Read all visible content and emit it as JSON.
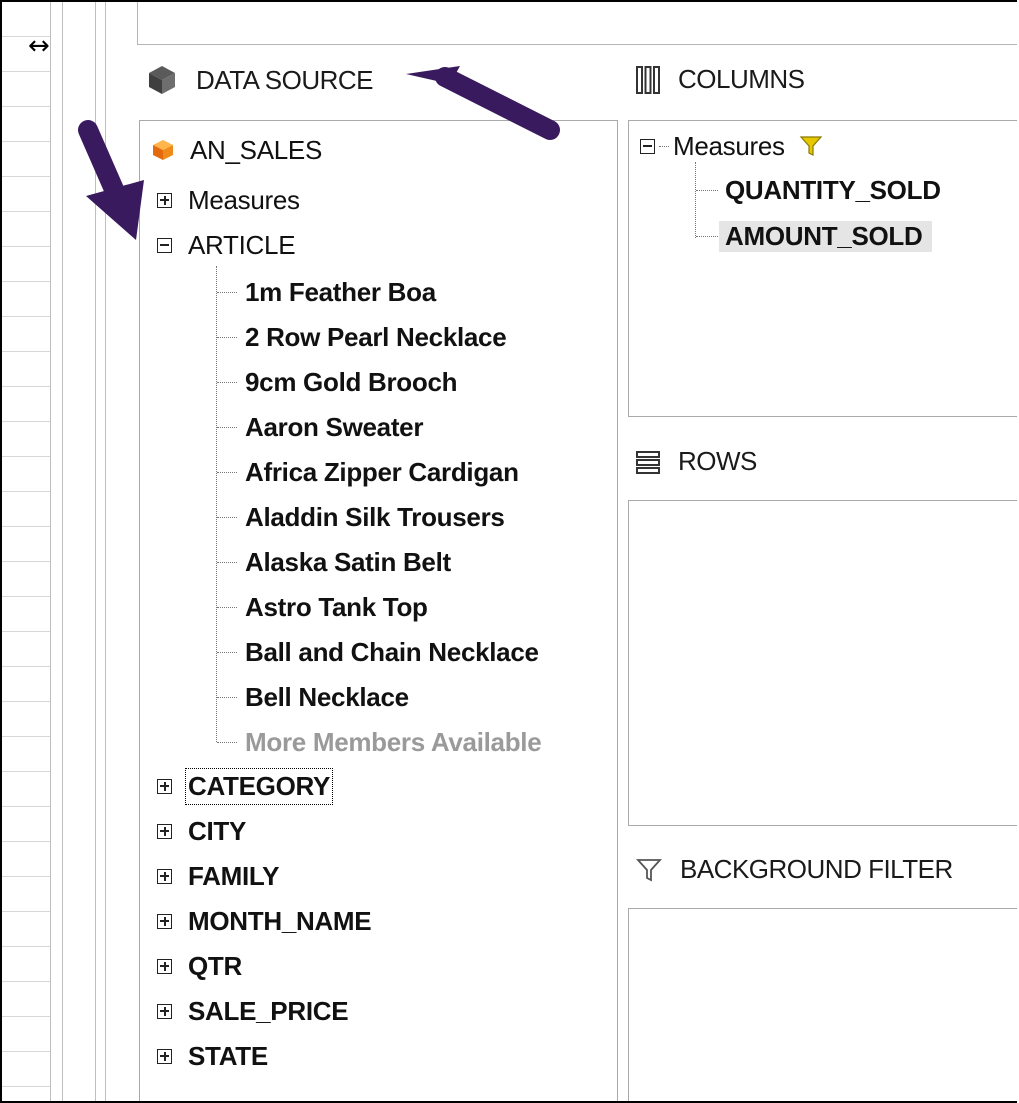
{
  "sections": {
    "data_source": "DATA SOURCE",
    "columns": "COLUMNS",
    "rows": "ROWS",
    "background_filter": "BACKGROUND FILTER"
  },
  "data_source_tree": {
    "root": "AN_SALES",
    "measures": "Measures",
    "article": {
      "label": "ARTICLE",
      "members": [
        "1m Feather Boa",
        "2 Row Pearl Necklace",
        "9cm Gold Brooch",
        "Aaron Sweater",
        "Africa Zipper Cardigan",
        "Aladdin Silk Trousers",
        "Alaska Satin Belt",
        "Astro Tank Top",
        "Ball and Chain Necklace",
        "Bell Necklace"
      ],
      "more": "More Members Available"
    },
    "dimensions": [
      "CATEGORY",
      "CITY",
      "FAMILY",
      "MONTH_NAME",
      "QTR",
      "SALE_PRICE",
      "STATE"
    ]
  },
  "columns_tree": {
    "label": "Measures",
    "items": [
      "QUANTITY_SOLD",
      "AMOUNT_SOLD"
    ]
  },
  "colors": {
    "arrow": "#3a1a5e",
    "filter_icon": "#e6c800",
    "cube_icon": "#f08a1a"
  }
}
